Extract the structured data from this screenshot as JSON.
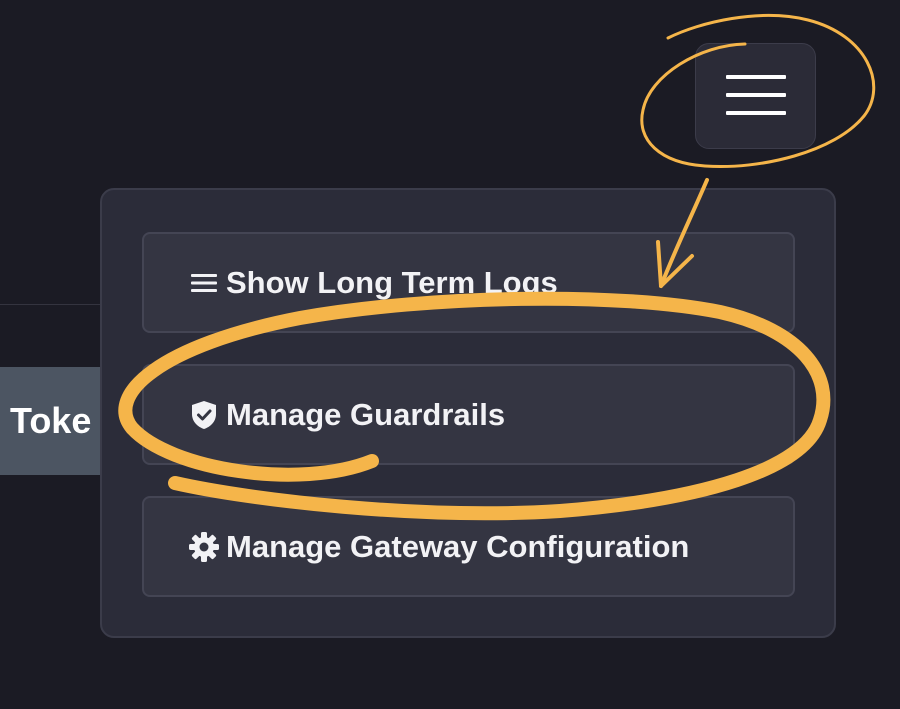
{
  "token_tab": {
    "label": "Toke"
  },
  "menu_toggle": {
    "icon": "hamburger-menu-icon"
  },
  "dropdown": {
    "items": [
      {
        "label": "Show Long Term Logs",
        "icon": "list-icon"
      },
      {
        "label": "Manage Guardrails",
        "icon": "shield-check-icon"
      },
      {
        "label": "Manage Gateway Configuration",
        "icon": "gear-icon"
      }
    ]
  },
  "colors": {
    "background": "#1b1b24",
    "panel": "#2b2c39",
    "item": "#343542",
    "annotation": "#f5b54a",
    "token_tab": "#4c5562"
  }
}
